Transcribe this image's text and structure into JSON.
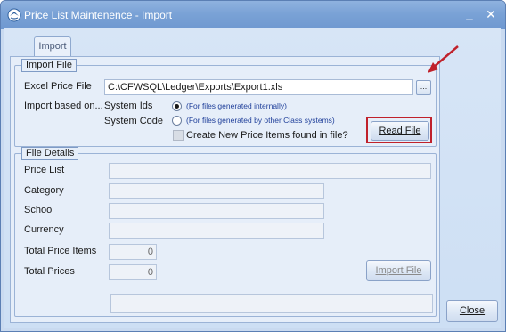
{
  "window": {
    "title": "Price List Maintenence - Import",
    "minimize_glyph": "_",
    "close_glyph": "✕"
  },
  "tabs": [
    {
      "label": "Import"
    }
  ],
  "import_file": {
    "legend": "Import File",
    "excel_label": "Excel Price File",
    "excel_value": "C:\\CFWSQL\\Ledger\\Exports\\Export1.xls",
    "browse_label": "...",
    "import_based_label": "Import based on...",
    "options": [
      {
        "label": "System Ids",
        "hint": "(For files generated internally)",
        "checked": true
      },
      {
        "label": "System Code",
        "hint": "(For files generated by other Class systems)",
        "checked": false
      }
    ],
    "create_new_label": "Create New Price Items found in file?",
    "read_file_label": "Read File"
  },
  "file_details": {
    "legend": "File Details",
    "price_list_label": "Price List",
    "category_label": "Category",
    "school_label": "School",
    "currency_label": "Currency",
    "total_items_label": "Total Price Items",
    "total_items_value": "0",
    "total_prices_label": "Total Prices",
    "total_prices_value": "0",
    "import_file_label": "Import File"
  },
  "footer": {
    "close_label": "Close"
  },
  "colors": {
    "highlight": "#c0212b",
    "hint_text": "#1f3f9a",
    "title_bar": "#7aa2d6"
  }
}
